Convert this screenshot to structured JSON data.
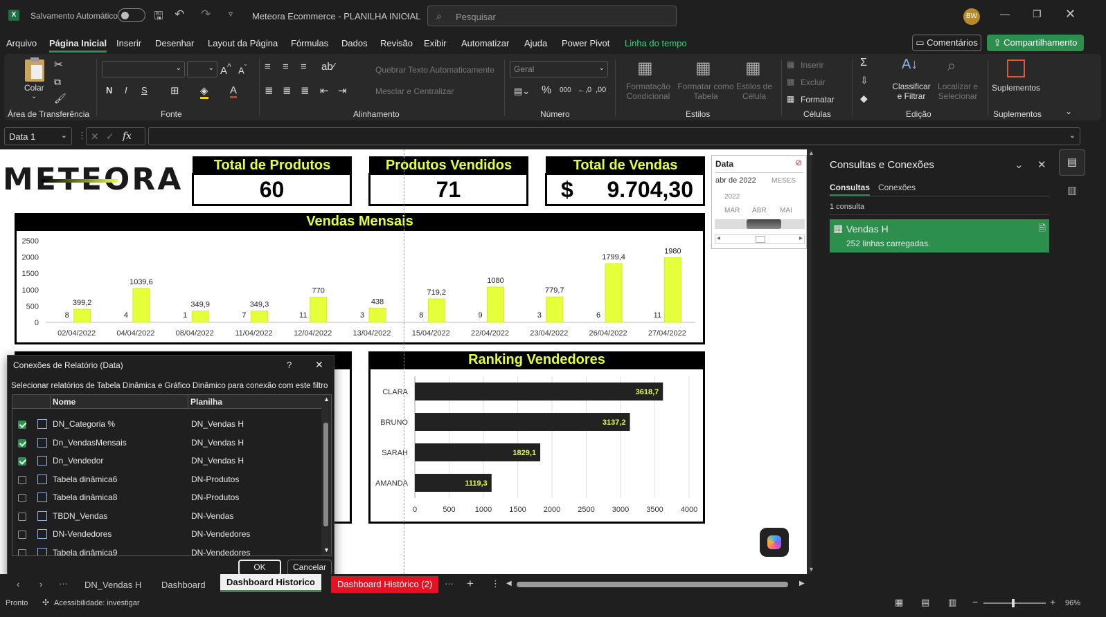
{
  "titlebar": {
    "autosave_label": "Salvamento Automático",
    "doc_title": "Meteora Ecommerce - PLANILHA INICIAL",
    "search_placeholder": "Pesquisar",
    "avatar_initials": "BW"
  },
  "menu": {
    "items": [
      "Arquivo",
      "Página Inicial",
      "Inserir",
      "Desenhar",
      "Layout da Página",
      "Fórmulas",
      "Dados",
      "Revisão",
      "Exibir",
      "Automatizar",
      "Ajuda",
      "Power Pivot",
      "Linha do tempo"
    ],
    "comments_label": "Comentários",
    "share_label": "Compartilhamento"
  },
  "ribbon": {
    "paste_label": "Colar",
    "groups": [
      "Área de Transferência",
      "Fonte",
      "Alinhamento",
      "Número",
      "Estilos",
      "Células",
      "Edição",
      "Suplementos"
    ],
    "wrap_text": "Quebrar Texto Automaticamente",
    "merge_center": "Mesclar e Centralizar",
    "number_format": "Geral",
    "cond_format": "Formatação Condicional",
    "format_table": "Formatar como Tabela",
    "cell_styles": "Estilos de Célula",
    "insert": "Inserir",
    "delete": "Excluir",
    "format": "Formatar",
    "sort_filter": "Classificar e Filtrar",
    "find_select": "Localizar e Selecionar",
    "addins": "Suplementos"
  },
  "formula_bar": {
    "name_box": "Data 1",
    "fx": "fx"
  },
  "dashboard": {
    "logo": "METEORA",
    "kpis": [
      {
        "label": "Total de Produtos",
        "value": "60"
      },
      {
        "label": "Produtos Vendidos",
        "value": "71"
      },
      {
        "label": "Total de Vendas",
        "currency": "$",
        "value": "9.704,30"
      }
    ]
  },
  "chart_data": [
    {
      "type": "bar",
      "title": "Vendas Mensais",
      "categories": [
        "02/04/2022",
        "04/04/2022",
        "08/04/2022",
        "11/04/2022",
        "12/04/2022",
        "13/04/2022",
        "15/04/2022",
        "22/04/2022",
        "23/04/2022",
        "26/04/2022",
        "27/04/2022"
      ],
      "values": [
        399.2,
        1039.6,
        349.9,
        349.3,
        770,
        438,
        719.2,
        1080,
        779.7,
        1799.4,
        1980
      ],
      "value_labels": [
        "399,2",
        "1039,6",
        "349,9",
        "349,3",
        "770",
        "438",
        "719,2",
        "1080",
        "779,7",
        "1799,4",
        "1980"
      ],
      "count_labels": [
        "8",
        "4",
        "1",
        "7",
        "11",
        "3",
        "8",
        "9",
        "3",
        "6",
        "11"
      ],
      "ylim": [
        0,
        2500
      ],
      "yticks": [
        0,
        500,
        1000,
        1500,
        2000,
        2500
      ],
      "bar_color": "#e6ff3b"
    },
    {
      "type": "bar",
      "orientation": "horizontal",
      "title": "Ranking Vendedores",
      "categories": [
        "CLARA",
        "BRUNO",
        "SARAH",
        "AMANDA"
      ],
      "values": [
        3618.7,
        3137.2,
        1829.1,
        1119.3
      ],
      "value_labels": [
        "3618,7",
        "3137,2",
        "1829,1",
        "1119,3"
      ],
      "xlim": [
        0,
        4000
      ],
      "xticks": [
        0,
        500,
        1000,
        1500,
        2000,
        2500,
        3000,
        3500,
        4000
      ],
      "bar_color": "#222222",
      "label_color": "#e6ff3b"
    }
  ],
  "slicer": {
    "title": "Data",
    "period": "abr de 2022",
    "level": "MESES",
    "year": "2022",
    "months": [
      "MAR",
      "ABR",
      "MAI"
    ]
  },
  "side_panel": {
    "title": "Consultas e Conexões",
    "tabs": [
      "Consultas",
      "Conexões"
    ],
    "count": "1 consulta",
    "query_name": "Vendas H",
    "query_info": "252 linhas carregadas."
  },
  "dialog": {
    "title": "Conexões de Relatório (Data)",
    "help": "?",
    "instructions": "Selecionar relatórios de Tabela Dinâmica e Gráfico Dinâmico para conexão com este filtro",
    "col_name": "Nome",
    "col_sheet": "Planilha",
    "rows": [
      {
        "name": "DN_Categoria %",
        "sheet": "DN_Vendas H",
        "checked": true
      },
      {
        "name": "Dn_VendasMensais",
        "sheet": "DN_Vendas H",
        "checked": true
      },
      {
        "name": "Dn_Vendedor",
        "sheet": "DN_Vendas H",
        "checked": true
      },
      {
        "name": "Tabela dinâmica6",
        "sheet": "DN-Produtos",
        "checked": false
      },
      {
        "name": "Tabela dinâmica8",
        "sheet": "DN-Produtos",
        "checked": false
      },
      {
        "name": "TBDN_Vendas",
        "sheet": "DN-Vendas",
        "checked": false
      },
      {
        "name": "DN-Vendedores",
        "sheet": "DN-Vendedores",
        "checked": false
      },
      {
        "name": "Tabela dinâmica9",
        "sheet": "DN-Vendedores",
        "checked": false
      }
    ],
    "ok": "OK",
    "cancel": "Cancelar"
  },
  "tabs": {
    "items": [
      "DN_Vendas H",
      "Dashboard",
      "Dashboard Historico",
      "Dashboard Histórico (2)"
    ],
    "active": "Dashboard Historico"
  },
  "status": {
    "ready": "Pronto",
    "accessibility": "Acessibilidade: investigar",
    "zoom": "96%"
  },
  "colors": {
    "accent_green": "#2d8f4e",
    "brand_yellow": "#e6ff3b",
    "tab_red": "#e81123"
  }
}
